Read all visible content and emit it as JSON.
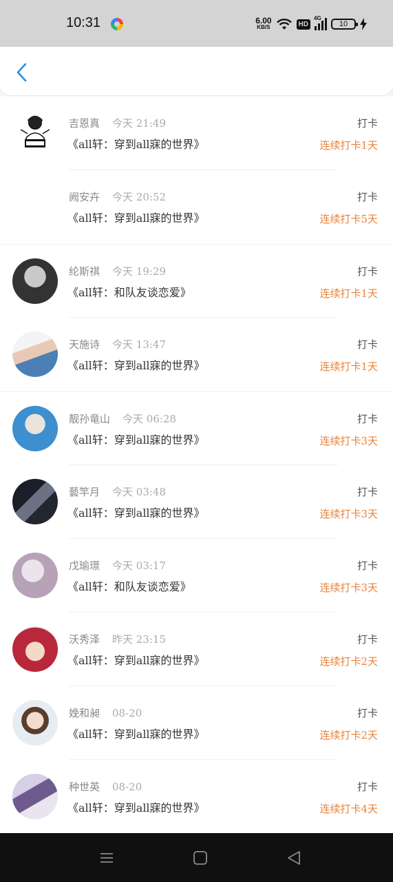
{
  "status_bar": {
    "time": "10:31",
    "speed_value": "6.00",
    "speed_unit": "KB/S",
    "hd": "HD",
    "network": "4G",
    "battery": "10"
  },
  "header": {
    "back_icon": "chevron-left-icon"
  },
  "entries": [
    {
      "name": "吉恩真",
      "time": "今天 21:49",
      "title": "《all轩：穿到all寐的世界》",
      "action": "打卡",
      "streak": "连续打卡1天"
    },
    {
      "name": "阙安卉",
      "time": "今天 20:52",
      "title": "《all轩：穿到all寐的世界》",
      "action": "打卡",
      "streak": "连续打卡5天"
    },
    {
      "name": "纶斯祺",
      "time": "今天 19:29",
      "title": "《all轩：和队友谈恋爱》",
      "action": "打卡",
      "streak": "连续打卡1天"
    },
    {
      "name": "天施诗",
      "time": "今天 13:47",
      "title": "《all轩：穿到all寐的世界》",
      "action": "打卡",
      "streak": "连续打卡1天"
    },
    {
      "name": "靓孙竜山",
      "time": "今天 06:28",
      "title": "《all轩：穿到all寐的世界》",
      "action": "打卡",
      "streak": "连续打卡3天"
    },
    {
      "name": "藝竿月",
      "time": "今天 03:48",
      "title": "《all轩：穿到all寐的世界》",
      "action": "打卡",
      "streak": "连续打卡3天"
    },
    {
      "name": "戊瑜璟",
      "time": "今天 03:17",
      "title": "《all轩：和队友谈恋爱》",
      "action": "打卡",
      "streak": "连续打卡3天"
    },
    {
      "name": "沃秀泽",
      "time": "昨天 23:15",
      "title": "《all轩：穿到all寐的世界》",
      "action": "打卡",
      "streak": "连续打卡2天"
    },
    {
      "name": "娩和昶",
      "time": "08-20",
      "title": "《all轩：穿到all寐的世界》",
      "action": "打卡",
      "streak": "连续打卡2天"
    },
    {
      "name": "种世英",
      "time": "08-20",
      "title": "《all轩：穿到all寐的世界》",
      "action": "打卡",
      "streak": "连续打卡4天"
    }
  ],
  "colors": {
    "accent_blue": "#2a8fe0",
    "streak_orange": "#e8833a",
    "status_gray": "#d4d4d4",
    "nav_black": "#101010"
  },
  "nav_bar": {
    "icons": [
      "menu-icon",
      "home-square-icon",
      "back-triangle-icon"
    ]
  }
}
